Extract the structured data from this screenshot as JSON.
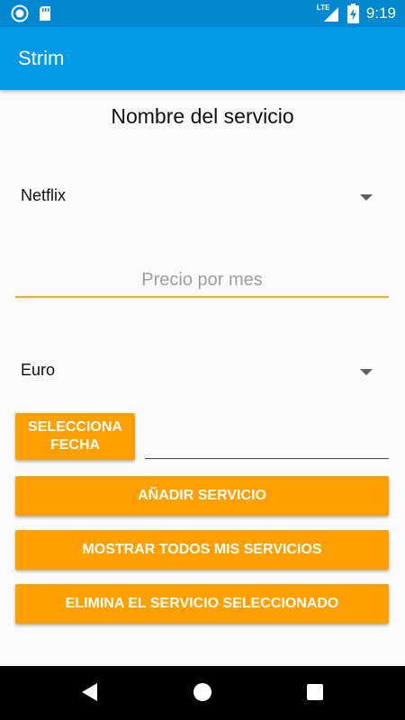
{
  "status_bar": {
    "time": "9:19",
    "network": "LTE",
    "icons": [
      "notification-circle-icon",
      "sd-card-icon",
      "signal-icon",
      "battery-charging-icon"
    ]
  },
  "app_bar": {
    "title": "Strim"
  },
  "form": {
    "heading": "Nombre del servicio",
    "service_spinner": {
      "value": "Netflix"
    },
    "price_field": {
      "placeholder": "Precio por mes",
      "value": ""
    },
    "currency_spinner": {
      "value": "Euro"
    },
    "date_button_line1": "SELECCIONA",
    "date_button_line2": "FECHA",
    "date_value": ""
  },
  "buttons": {
    "add": "AÑADIR SERVICIO",
    "show_all": "MOSTRAR TODOS MIS SERVICIOS",
    "delete": "ELIMINA EL SERVICIO SELECCIONADO"
  },
  "colors": {
    "status_bar": "#0288d1",
    "app_bar": "#039be5",
    "accent": "#ffa000",
    "underline": "#f5a623"
  },
  "nav_bar": {
    "icons": [
      "back-icon",
      "home-icon",
      "recents-icon"
    ]
  }
}
